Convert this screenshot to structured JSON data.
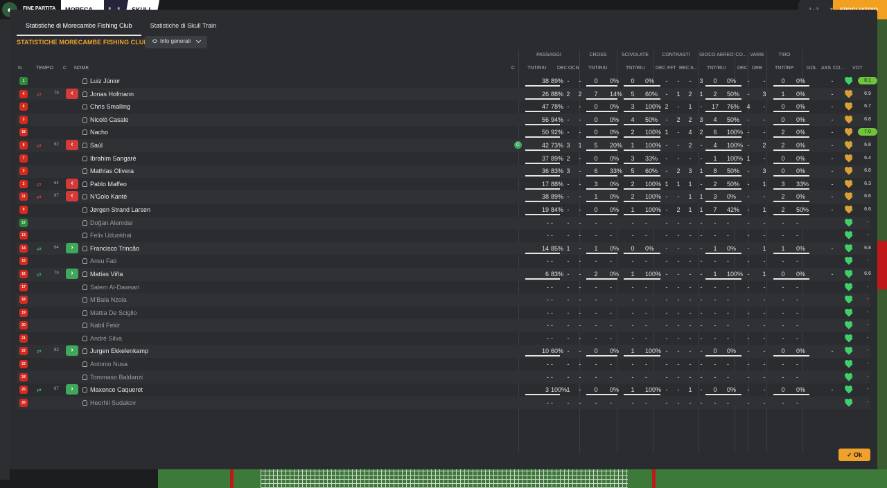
{
  "topbar": {
    "label": "FINE PARTITA",
    "home": "MORECA",
    "score": "1 - 1",
    "away": "SKULL",
    "right_score": "1 - 2",
    "close": "✕",
    "right_button": "SPOGLIATOIO"
  },
  "tabs": [
    {
      "label": "Statistiche di Morecambe Fishing Club",
      "active": true
    },
    {
      "label": "Statistiche di Skull Train",
      "active": false
    }
  ],
  "section_title": "STATISTICHE MORECAMBE FISHING CLUB",
  "dropdown": {
    "label": "Info generali"
  },
  "group_headers": {
    "passaggi": "PASSAGGI",
    "cross": "CROSS",
    "scivolate": "SCIVOLATE",
    "contrasti": "CONTRASTI",
    "gioco_aereo": "GIOCO AEREO",
    "co": "CO...",
    "varie": "VARIE",
    "tiro": "TIRO"
  },
  "column_headers": {
    "n": "N.",
    "tempo": "TEMPO",
    "c": "C",
    "nome": "NOME",
    "c2": "C",
    "pass_tntriu": "TNT/RIU",
    "pass_dec": "DEC",
    "pass_ocn": "OCN",
    "cross_tntriu": "TNT/RIU",
    "sciv_tntriu": "TNT/RIU",
    "con_dec": "DEC",
    "con_fft": "FFT",
    "con_rec": "REC",
    "con_s": "S...",
    "aer_tntriu": "TNT/RIU",
    "co_dec": "DEC",
    "varie_drb": "DRB",
    "tiro_tntinp": "TNT/INP",
    "gol": "GOL",
    "ass": "ASS",
    "co2": "CO...",
    "vot": "VOT"
  },
  "heart_colors": {
    "green": "#3fd06a",
    "amber": "#d9a038"
  },
  "players": [
    {
      "num": "1",
      "gk": true,
      "arrow": "",
      "time": "",
      "sub": "",
      "name": "Luiz Júnior",
      "c_icon": "",
      "pass_t": "38",
      "pass_p": "89%",
      "pass_dec": "-",
      "pass_ocn": "-",
      "cross_t": "0",
      "cross_p": "0%",
      "sciv_t": "0",
      "sciv_p": "0%",
      "con_dec": "-",
      "con_fft": "-",
      "con_rec": "-",
      "con_s": "3",
      "aer_t": "0",
      "aer_p": "0%",
      "co_dec": "-",
      "drb": "-",
      "tiro_t": "0",
      "tiro_p": "0%",
      "gol": "",
      "ass": "-",
      "heart": "green",
      "vot": "8.1",
      "vot_hi": true
    },
    {
      "num": "4",
      "gk": false,
      "arrow": "out",
      "time": "79",
      "sub": "out",
      "name": "Jonas Hofmann",
      "c_icon": "",
      "pass_t": "26",
      "pass_p": "88%",
      "pass_dec": "2",
      "pass_ocn": "2",
      "cross_t": "7",
      "cross_p": "14%",
      "sciv_t": "5",
      "sciv_p": "60%",
      "con_dec": "-",
      "con_fft": "1",
      "con_rec": "2",
      "con_s": "1",
      "aer_t": "2",
      "aer_p": "50%",
      "co_dec": "-",
      "drb": "3",
      "tiro_t": "1",
      "tiro_p": "0%",
      "gol": "",
      "ass": "-",
      "heart": "amber",
      "vot": "6.9",
      "vot_hi": false
    },
    {
      "num": "6",
      "gk": false,
      "arrow": "",
      "time": "",
      "sub": "",
      "name": "Chris Smalling",
      "c_icon": "",
      "pass_t": "47",
      "pass_p": "78%",
      "pass_dec": "-",
      "pass_ocn": "-",
      "cross_t": "0",
      "cross_p": "0%",
      "sciv_t": "3",
      "sciv_p": "100%",
      "con_dec": "2",
      "con_fft": "-",
      "con_rec": "1",
      "con_s": "-",
      "aer_t": "17",
      "aer_p": "76%",
      "co_dec": "4",
      "drb": "-",
      "tiro_t": "0",
      "tiro_p": "0%",
      "gol": "",
      "ass": "-",
      "heart": "amber",
      "vot": "6.7",
      "vot_hi": false
    },
    {
      "num": "3",
      "gk": false,
      "arrow": "",
      "time": "",
      "sub": "",
      "name": "Nicolò Casale",
      "c_icon": "",
      "pass_t": "56",
      "pass_p": "94%",
      "pass_dec": "-",
      "pass_ocn": "-",
      "cross_t": "0",
      "cross_p": "0%",
      "sciv_t": "4",
      "sciv_p": "50%",
      "con_dec": "-",
      "con_fft": "2",
      "con_rec": "2",
      "con_s": "3",
      "aer_t": "4",
      "aer_p": "50%",
      "co_dec": "-",
      "drb": "-",
      "tiro_t": "0",
      "tiro_p": "0%",
      "gol": "",
      "ass": "-",
      "heart": "amber",
      "vot": "6.8",
      "vot_hi": false
    },
    {
      "num": "18",
      "gk": false,
      "arrow": "",
      "time": "",
      "sub": "",
      "name": "Nacho",
      "c_icon": "",
      "pass_t": "50",
      "pass_p": "92%",
      "pass_dec": "-",
      "pass_ocn": "-",
      "cross_t": "0",
      "cross_p": "0%",
      "sciv_t": "2",
      "sciv_p": "100%",
      "con_dec": "1",
      "con_fft": "-",
      "con_rec": "4",
      "con_s": "2",
      "aer_t": "6",
      "aer_p": "100%",
      "co_dec": "-",
      "drb": "-",
      "tiro_t": "2",
      "tiro_p": "0%",
      "gol": "",
      "ass": "-",
      "heart": "amber",
      "vot": "7.0",
      "vot_hi": true
    },
    {
      "num": "8",
      "gk": false,
      "arrow": "out",
      "time": "82",
      "sub": "out",
      "name": "Saúl",
      "c_icon": "C",
      "pass_t": "42",
      "pass_p": "73%",
      "pass_dec": "3",
      "pass_ocn": "1",
      "cross_t": "5",
      "cross_p": "20%",
      "sciv_t": "1",
      "sciv_p": "100%",
      "con_dec": "-",
      "con_fft": "-",
      "con_rec": "2",
      "con_s": "-",
      "aer_t": "4",
      "aer_p": "100%",
      "co_dec": "-",
      "drb": "2",
      "tiro_t": "2",
      "tiro_p": "0%",
      "gol": "",
      "ass": "-",
      "heart": "amber",
      "vot": "6.8",
      "vot_hi": false
    },
    {
      "num": "7",
      "gk": false,
      "arrow": "",
      "time": "",
      "sub": "",
      "name": "Ibrahim Sangaré",
      "c_icon": "",
      "pass_t": "37",
      "pass_p": "89%",
      "pass_dec": "2",
      "pass_ocn": "-",
      "cross_t": "0",
      "cross_p": "0%",
      "sciv_t": "3",
      "sciv_p": "33%",
      "con_dec": "-",
      "con_fft": "-",
      "con_rec": "-",
      "con_s": "-",
      "aer_t": "1",
      "aer_p": "100%",
      "co_dec": "1",
      "drb": "-",
      "tiro_t": "0",
      "tiro_p": "0%",
      "gol": "",
      "ass": "-",
      "heart": "amber",
      "vot": "6.4",
      "vot_hi": false
    },
    {
      "num": "3",
      "gk": false,
      "arrow": "",
      "time": "",
      "sub": "",
      "name": "Mathías Olivera",
      "c_icon": "",
      "pass_t": "36",
      "pass_p": "83%",
      "pass_dec": "3",
      "pass_ocn": "-",
      "cross_t": "6",
      "cross_p": "33%",
      "sciv_t": "5",
      "sciv_p": "60%",
      "con_dec": "-",
      "con_fft": "2",
      "con_rec": "3",
      "con_s": "1",
      "aer_t": "8",
      "aer_p": "50%",
      "co_dec": "-",
      "drb": "3",
      "tiro_t": "0",
      "tiro_p": "0%",
      "gol": "",
      "ass": "-",
      "heart": "amber",
      "vot": "6.8",
      "vot_hi": false
    },
    {
      "num": "2",
      "gk": false,
      "arrow": "out",
      "time": "64",
      "sub": "out",
      "name": "Pablo Maffeo",
      "c_icon": "",
      "pass_t": "17",
      "pass_p": "88%",
      "pass_dec": "-",
      "pass_ocn": "-",
      "cross_t": "3",
      "cross_p": "0%",
      "sciv_t": "2",
      "sciv_p": "100%",
      "con_dec": "1",
      "con_fft": "1",
      "con_rec": "1",
      "con_s": "-",
      "aer_t": "2",
      "aer_p": "50%",
      "co_dec": "-",
      "drb": "1",
      "tiro_t": "3",
      "tiro_p": "33%",
      "gol": "",
      "ass": "-",
      "heart": "amber",
      "vot": "6.3",
      "vot_hi": false
    },
    {
      "num": "11",
      "gk": false,
      "arrow": "out",
      "time": "87",
      "sub": "out",
      "name": "N'Golo Kanté",
      "c_icon": "",
      "pass_t": "38",
      "pass_p": "89%",
      "pass_dec": "-",
      "pass_ocn": "-",
      "cross_t": "1",
      "cross_p": "0%",
      "sciv_t": "2",
      "sciv_p": "100%",
      "con_dec": "-",
      "con_fft": "-",
      "con_rec": "1",
      "con_s": "1",
      "aer_t": "3",
      "aer_p": "0%",
      "co_dec": "-",
      "drb": "-",
      "tiro_t": "2",
      "tiro_p": "0%",
      "gol": "",
      "ass": "-",
      "heart": "amber",
      "vot": "6.6",
      "vot_hi": false
    },
    {
      "num": "9",
      "gk": false,
      "arrow": "",
      "time": "",
      "sub": "",
      "name": "Jørgen Strand Larsen",
      "c_icon": "",
      "pass_t": "19",
      "pass_p": "84%",
      "pass_dec": "-",
      "pass_ocn": "-",
      "cross_t": "0",
      "cross_p": "0%",
      "sciv_t": "1",
      "sciv_p": "100%",
      "con_dec": "-",
      "con_fft": "2",
      "con_rec": "1",
      "con_s": "1",
      "aer_t": "7",
      "aer_p": "42%",
      "co_dec": "-",
      "drb": "1",
      "tiro_t": "2",
      "tiro_p": "50%",
      "gol": "",
      "ass": "-",
      "heart": "amber",
      "vot": "6.6",
      "vot_hi": false
    },
    {
      "num": "12",
      "gk": true,
      "arrow": "",
      "time": "",
      "sub": "",
      "name": "Doğan Alemdar",
      "c_icon": "",
      "pass_t": "-",
      "pass_p": "-",
      "pass_dec": "-",
      "pass_ocn": "-",
      "cross_t": "-",
      "cross_p": "-",
      "sciv_t": "-",
      "sciv_p": "-",
      "con_dec": "-",
      "con_fft": "-",
      "con_rec": "-",
      "con_s": "-",
      "aer_t": "-",
      "aer_p": "-",
      "co_dec": "-",
      "drb": "-",
      "tiro_t": "-",
      "tiro_p": "-",
      "gol": "",
      "ass": "",
      "heart": "green",
      "vot": "-",
      "vot_hi": false
    },
    {
      "num": "13",
      "gk": false,
      "arrow": "",
      "time": "",
      "sub": "",
      "name": "Felix Uduokhai",
      "c_icon": "",
      "pass_t": "-",
      "pass_p": "-",
      "pass_dec": "-",
      "pass_ocn": "-",
      "cross_t": "-",
      "cross_p": "-",
      "sciv_t": "-",
      "sciv_p": "-",
      "con_dec": "-",
      "con_fft": "-",
      "con_rec": "-",
      "con_s": "-",
      "aer_t": "-",
      "aer_p": "-",
      "co_dec": "-",
      "drb": "-",
      "tiro_t": "-",
      "tiro_p": "-",
      "gol": "",
      "ass": "",
      "heart": "green",
      "vot": "-",
      "vot_hi": false
    },
    {
      "num": "14",
      "gk": false,
      "arrow": "in",
      "time": "64",
      "sub": "in",
      "name": "Francisco Trincão",
      "c_icon": "",
      "pass_t": "14",
      "pass_p": "85%",
      "pass_dec": "1",
      "pass_ocn": "-",
      "cross_t": "1",
      "cross_p": "0%",
      "sciv_t": "0",
      "sciv_p": "0%",
      "con_dec": "-",
      "con_fft": "-",
      "con_rec": "-",
      "con_s": "-",
      "aer_t": "1",
      "aer_p": "0%",
      "co_dec": "-",
      "drb": "1",
      "tiro_t": "1",
      "tiro_p": "0%",
      "gol": "",
      "ass": "-",
      "heart": "green",
      "vot": "6.8",
      "vot_hi": false
    },
    {
      "num": "15",
      "gk": false,
      "arrow": "",
      "time": "",
      "sub": "",
      "name": "Ansu Fati",
      "c_icon": "",
      "pass_t": "-",
      "pass_p": "-",
      "pass_dec": "-",
      "pass_ocn": "-",
      "cross_t": "-",
      "cross_p": "-",
      "sciv_t": "-",
      "sciv_p": "-",
      "con_dec": "-",
      "con_fft": "-",
      "con_rec": "-",
      "con_s": "-",
      "aer_t": "-",
      "aer_p": "-",
      "co_dec": "-",
      "drb": "-",
      "tiro_t": "-",
      "tiro_p": "-",
      "gol": "",
      "ass": "",
      "heart": "green",
      "vot": "-",
      "vot_hi": false
    },
    {
      "num": "16",
      "gk": false,
      "arrow": "in",
      "time": "79",
      "sub": "in",
      "name": "Matías Viña",
      "c_icon": "",
      "pass_t": "6",
      "pass_p": "83%",
      "pass_dec": "-",
      "pass_ocn": "-",
      "cross_t": "2",
      "cross_p": "0%",
      "sciv_t": "1",
      "sciv_p": "100%",
      "con_dec": "-",
      "con_fft": "-",
      "con_rec": "-",
      "con_s": "-",
      "aer_t": "1",
      "aer_p": "100%",
      "co_dec": "-",
      "drb": "1",
      "tiro_t": "0",
      "tiro_p": "0%",
      "gol": "",
      "ass": "-",
      "heart": "green",
      "vot": "6.6",
      "vot_hi": false
    },
    {
      "num": "17",
      "gk": false,
      "arrow": "",
      "time": "",
      "sub": "",
      "name": "Salem Al-Dawsari",
      "c_icon": "",
      "pass_t": "-",
      "pass_p": "-",
      "pass_dec": "-",
      "pass_ocn": "-",
      "cross_t": "-",
      "cross_p": "-",
      "sciv_t": "-",
      "sciv_p": "-",
      "con_dec": "-",
      "con_fft": "-",
      "con_rec": "-",
      "con_s": "-",
      "aer_t": "-",
      "aer_p": "-",
      "co_dec": "-",
      "drb": "-",
      "tiro_t": "-",
      "tiro_p": "-",
      "gol": "",
      "ass": "",
      "heart": "green",
      "vot": "-",
      "vot_hi": false
    },
    {
      "num": "18",
      "gk": false,
      "arrow": "",
      "time": "",
      "sub": "",
      "name": "M'Bala Nzola",
      "c_icon": "",
      "pass_t": "-",
      "pass_p": "-",
      "pass_dec": "-",
      "pass_ocn": "-",
      "cross_t": "-",
      "cross_p": "-",
      "sciv_t": "-",
      "sciv_p": "-",
      "con_dec": "-",
      "con_fft": "-",
      "con_rec": "-",
      "con_s": "-",
      "aer_t": "-",
      "aer_p": "-",
      "co_dec": "-",
      "drb": "-",
      "tiro_t": "-",
      "tiro_p": "-",
      "gol": "",
      "ass": "",
      "heart": "green",
      "vot": "-",
      "vot_hi": false
    },
    {
      "num": "19",
      "gk": false,
      "arrow": "",
      "time": "",
      "sub": "",
      "name": "Mattia De Sciglio",
      "c_icon": "",
      "pass_t": "-",
      "pass_p": "-",
      "pass_dec": "-",
      "pass_ocn": "-",
      "cross_t": "-",
      "cross_p": "-",
      "sciv_t": "-",
      "sciv_p": "-",
      "con_dec": "-",
      "con_fft": "-",
      "con_rec": "-",
      "con_s": "-",
      "aer_t": "-",
      "aer_p": "-",
      "co_dec": "-",
      "drb": "-",
      "tiro_t": "-",
      "tiro_p": "-",
      "gol": "",
      "ass": "",
      "heart": "green",
      "vot": "-",
      "vot_hi": false
    },
    {
      "num": "20",
      "gk": false,
      "arrow": "",
      "time": "",
      "sub": "",
      "name": "Nabil Fekir",
      "c_icon": "",
      "pass_t": "-",
      "pass_p": "-",
      "pass_dec": "-",
      "pass_ocn": "-",
      "cross_t": "-",
      "cross_p": "-",
      "sciv_t": "-",
      "sciv_p": "-",
      "con_dec": "-",
      "con_fft": "-",
      "con_rec": "-",
      "con_s": "-",
      "aer_t": "-",
      "aer_p": "-",
      "co_dec": "-",
      "drb": "-",
      "tiro_t": "-",
      "tiro_p": "-",
      "gol": "",
      "ass": "",
      "heart": "green",
      "vot": "-",
      "vot_hi": false
    },
    {
      "num": "21",
      "gk": false,
      "arrow": "",
      "time": "",
      "sub": "",
      "name": "André Silva",
      "c_icon": "",
      "pass_t": "-",
      "pass_p": "-",
      "pass_dec": "-",
      "pass_ocn": "-",
      "cross_t": "-",
      "cross_p": "-",
      "sciv_t": "-",
      "sciv_p": "-",
      "con_dec": "-",
      "con_fft": "-",
      "con_rec": "-",
      "con_s": "-",
      "aer_t": "-",
      "aer_p": "-",
      "co_dec": "-",
      "drb": "-",
      "tiro_t": "-",
      "tiro_p": "-",
      "gol": "",
      "ass": "",
      "heart": "green",
      "vot": "-",
      "vot_hi": false
    },
    {
      "num": "22",
      "gk": false,
      "arrow": "in",
      "time": "82",
      "sub": "in",
      "name": "Jurgen Ekkelenkamp",
      "c_icon": "",
      "pass_t": "10",
      "pass_p": "60%",
      "pass_dec": "-",
      "pass_ocn": "-",
      "cross_t": "0",
      "cross_p": "0%",
      "sciv_t": "1",
      "sciv_p": "100%",
      "con_dec": "-",
      "con_fft": "-",
      "con_rec": "-",
      "con_s": "-",
      "aer_t": "0",
      "aer_p": "0%",
      "co_dec": "-",
      "drb": "-",
      "tiro_t": "0",
      "tiro_p": "0%",
      "gol": "",
      "ass": "-",
      "heart": "green",
      "vot": "-",
      "vot_hi": false
    },
    {
      "num": "23",
      "gk": false,
      "arrow": "",
      "time": "",
      "sub": "",
      "name": "Antonio Nusa",
      "c_icon": "",
      "pass_t": "-",
      "pass_p": "-",
      "pass_dec": "-",
      "pass_ocn": "-",
      "cross_t": "-",
      "cross_p": "-",
      "sciv_t": "-",
      "sciv_p": "-",
      "con_dec": "-",
      "con_fft": "-",
      "con_rec": "-",
      "con_s": "-",
      "aer_t": "-",
      "aer_p": "-",
      "co_dec": "-",
      "drb": "-",
      "tiro_t": "-",
      "tiro_p": "-",
      "gol": "",
      "ass": "",
      "heart": "green",
      "vot": "-",
      "vot_hi": false
    },
    {
      "num": "24",
      "gk": false,
      "arrow": "",
      "time": "",
      "sub": "",
      "name": "Tommaso Baldanzi",
      "c_icon": "",
      "pass_t": "-",
      "pass_p": "-",
      "pass_dec": "-",
      "pass_ocn": "-",
      "cross_t": "-",
      "cross_p": "-",
      "sciv_t": "-",
      "sciv_p": "-",
      "con_dec": "-",
      "con_fft": "-",
      "con_rec": "-",
      "con_s": "-",
      "aer_t": "-",
      "aer_p": "-",
      "co_dec": "-",
      "drb": "-",
      "tiro_t": "-",
      "tiro_p": "-",
      "gol": "",
      "ass": "",
      "heart": "green",
      "vot": "-",
      "vot_hi": false
    },
    {
      "num": "25",
      "gk": false,
      "arrow": "in",
      "time": "87",
      "sub": "in",
      "name": "Maxence Caqueret",
      "c_icon": "",
      "pass_t": "3",
      "pass_p": "100%",
      "pass_dec": "1",
      "pass_ocn": "-",
      "cross_t": "0",
      "cross_p": "0%",
      "sciv_t": "1",
      "sciv_p": "100%",
      "con_dec": "-",
      "con_fft": "-",
      "con_rec": "1",
      "con_s": "-",
      "aer_t": "0",
      "aer_p": "0%",
      "co_dec": "-",
      "drb": "-",
      "tiro_t": "0",
      "tiro_p": "0%",
      "gol": "",
      "ass": "-",
      "heart": "green",
      "vot": "-",
      "vot_hi": false
    },
    {
      "num": "26",
      "gk": false,
      "arrow": "",
      "time": "",
      "sub": "",
      "name": "Heorhii Sudakov",
      "c_icon": "",
      "pass_t": "-",
      "pass_p": "-",
      "pass_dec": "-",
      "pass_ocn": "-",
      "cross_t": "-",
      "cross_p": "-",
      "sciv_t": "-",
      "sciv_p": "-",
      "con_dec": "-",
      "con_fft": "-",
      "con_rec": "-",
      "con_s": "-",
      "aer_t": "-",
      "aer_p": "-",
      "co_dec": "-",
      "drb": "-",
      "tiro_t": "-",
      "tiro_p": "-",
      "gol": "",
      "ass": "",
      "heart": "green",
      "vot": "-",
      "vot_hi": false
    }
  ],
  "ok_button": {
    "label": "Ok"
  }
}
